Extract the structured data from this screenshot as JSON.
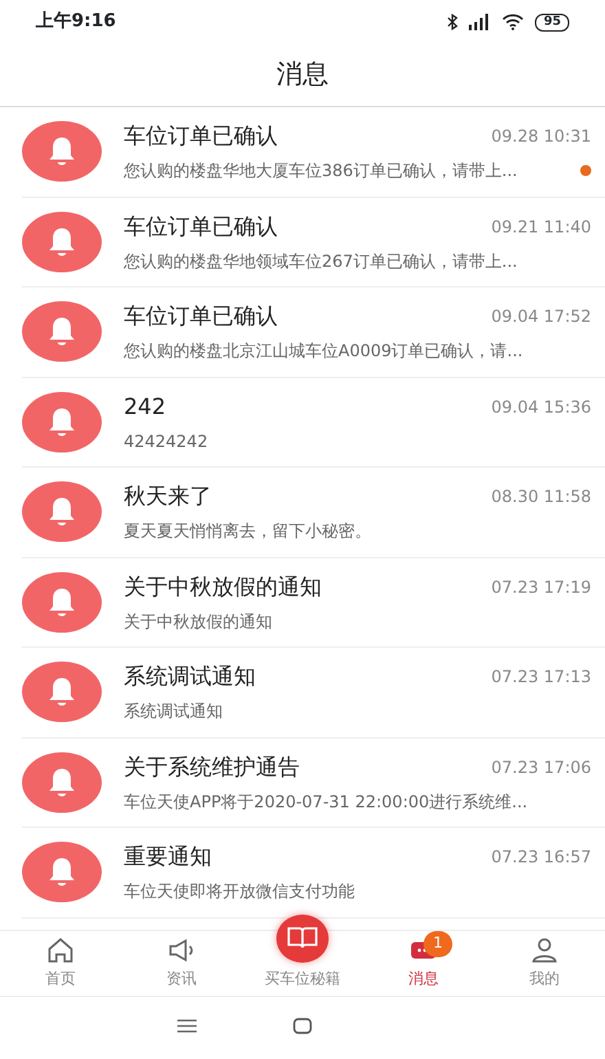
{
  "status_bar": {
    "time": "上午9:16",
    "battery": "95"
  },
  "header": {
    "title": "消息"
  },
  "messages": [
    {
      "title": "车位订单已确认",
      "time": "09.28 10:31",
      "preview": "您认购的楼盘华地大厦车位386订单已确认，请带上...",
      "unread": true
    },
    {
      "title": "车位订单已确认",
      "time": "09.21 11:40",
      "preview": "您认购的楼盘华地领域车位267订单已确认，请带上...",
      "unread": false
    },
    {
      "title": "车位订单已确认",
      "time": "09.04 17:52",
      "preview": "您认购的楼盘北京江山城车位A0009订单已确认，请...",
      "unread": false
    },
    {
      "title": "242",
      "time": "09.04 15:36",
      "preview": "42424242",
      "unread": false
    },
    {
      "title": "秋天来了",
      "time": "08.30 11:58",
      "preview": "夏天夏天悄悄离去，留下小秘密。",
      "unread": false
    },
    {
      "title": "关于中秋放假的通知",
      "time": "07.23 17:19",
      "preview": "关于中秋放假的通知",
      "unread": false
    },
    {
      "title": "系统调试通知",
      "time": "07.23 17:13",
      "preview": "系统调试通知",
      "unread": false
    },
    {
      "title": "关于系统维护通告",
      "time": "07.23 17:06",
      "preview": "车位天使APP将于2020-07-31 22:00:00进行系统维...",
      "unread": false
    },
    {
      "title": "重要通知",
      "time": "07.23 16:57",
      "preview": "车位天使即将开放微信支付功能",
      "unread": false
    }
  ],
  "tab_bar": [
    {
      "kind": "home",
      "label": "首页",
      "selected": false
    },
    {
      "kind": "news",
      "label": "资讯",
      "selected": false
    },
    {
      "kind": "guide",
      "label": "买车位秘籍",
      "selected": false
    },
    {
      "kind": "messages",
      "label": "消息",
      "selected": true,
      "badge": "1"
    },
    {
      "kind": "profile",
      "label": "我的",
      "selected": false
    }
  ]
}
